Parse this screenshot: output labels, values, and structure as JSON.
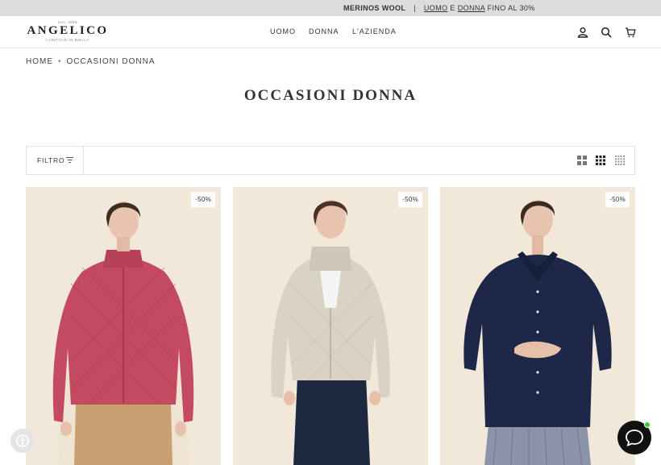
{
  "announcement": {
    "part1": "MERINOS WOOL",
    "separator": "|",
    "uomo": "UOMO",
    "and": "E",
    "donna": "DONNA",
    "rest": "FINO AL 30%"
  },
  "logo": {
    "since": "DAL 1899",
    "brand": "ANGELICO",
    "tagline": "LANIFICIO IN BIELLA"
  },
  "nav": [
    "UOMO",
    "DONNA",
    "L'AZIENDA"
  ],
  "header_icons": [
    "account-icon",
    "search-icon",
    "cart-icon"
  ],
  "breadcrumb": {
    "home": "HOME",
    "current": "OCCASIONI DONNA"
  },
  "page_title": "OCCASIONI DONNA",
  "toolbar": {
    "filter_label": "FILTRO"
  },
  "products": [
    {
      "badge": "-50%",
      "color": "#c44a61",
      "name": "pink quilted jacket"
    },
    {
      "badge": "-50%",
      "color": "#d8d2c4",
      "name": "beige quilted jacket"
    },
    {
      "badge": "-50%",
      "color": "#1e2747",
      "name": "navy blouse"
    }
  ],
  "colors": {
    "announce_bg": "#dcdcdc",
    "photo_bg": "#efe6d8",
    "text": "#333333"
  }
}
